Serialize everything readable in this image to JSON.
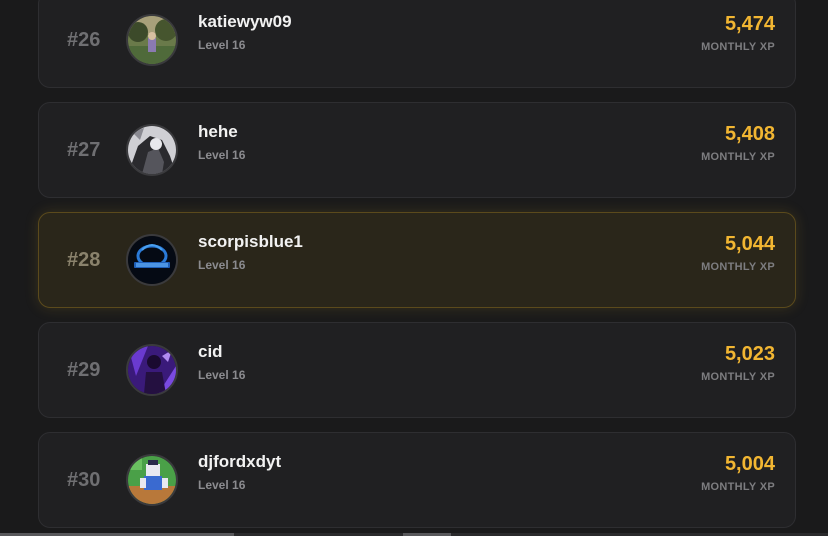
{
  "leaderboard": {
    "xp_label": "MONTHLY XP",
    "entries": [
      {
        "rank": "#26",
        "username": "katiewyw09",
        "level": "Level 16",
        "xp": "5,474",
        "avatar_icon": "landscape-avatar-icon"
      },
      {
        "rank": "#27",
        "username": "hehe",
        "level": "Level 16",
        "xp": "5,408",
        "avatar_icon": "monochrome-character-avatar-icon"
      },
      {
        "rank": "#28",
        "username": "scorpisblue1",
        "level": "Level 16",
        "xp": "5,044",
        "avatar_icon": "blue-scorpion-logo-avatar-icon",
        "highlighted": true
      },
      {
        "rank": "#29",
        "username": "cid",
        "level": "Level 16",
        "xp": "5,023",
        "avatar_icon": "purple-character-avatar-icon"
      },
      {
        "rank": "#30",
        "username": "djfordxdyt",
        "level": "Level 16",
        "xp": "5,004",
        "avatar_icon": "blocky-game-avatar-icon"
      }
    ]
  },
  "colors": {
    "background": "#1a1a1b",
    "card": "#202022",
    "highlight_card": "#2a261a",
    "xp_accent": "#f2b632"
  }
}
